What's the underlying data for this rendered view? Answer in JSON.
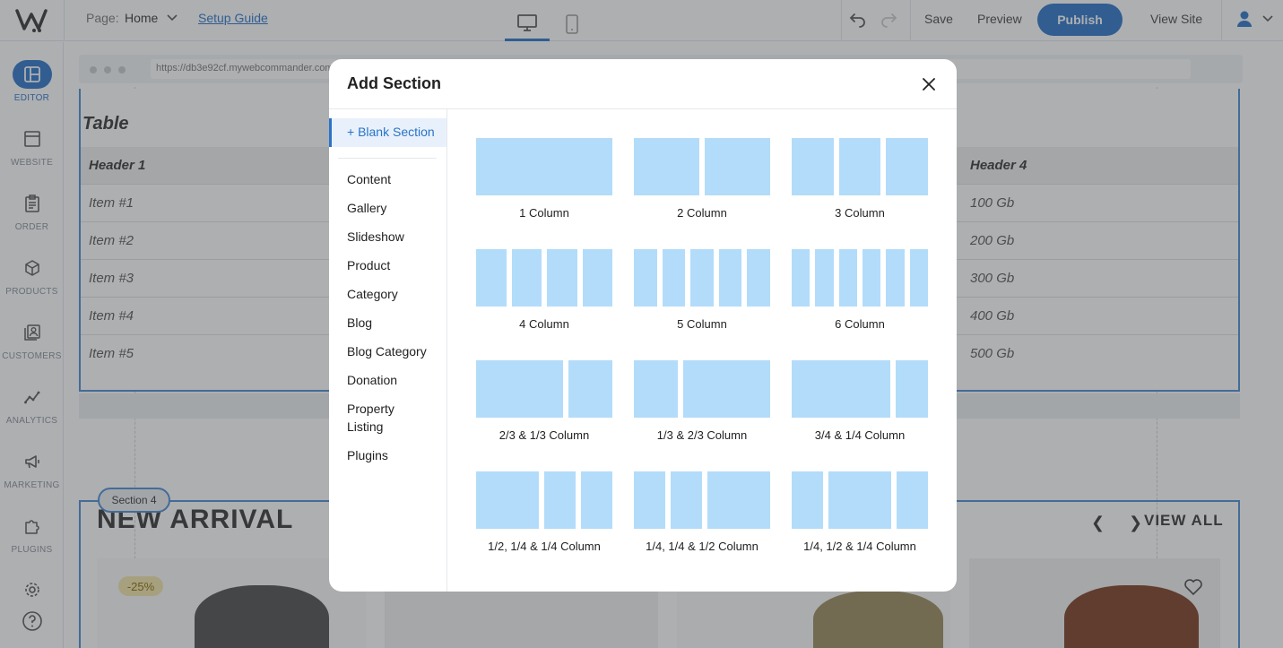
{
  "topbar": {
    "page_label": "Page:",
    "page_value": "Home",
    "setup_guide": "Setup Guide",
    "save": "Save",
    "preview": "Preview",
    "publish": "Publish",
    "view_site": "View Site"
  },
  "sidebar": {
    "items": [
      {
        "label": "EDITOR",
        "icon": "editor-icon",
        "active": true
      },
      {
        "label": "WEBSITE",
        "icon": "website-icon"
      },
      {
        "label": "ORDER",
        "icon": "order-icon"
      },
      {
        "label": "PRODUCTS",
        "icon": "products-icon"
      },
      {
        "label": "CUSTOMERS",
        "icon": "customers-icon"
      },
      {
        "label": "ANALYTICS",
        "icon": "analytics-icon"
      },
      {
        "label": "MARKETING",
        "icon": "marketing-icon"
      },
      {
        "label": "PLUGINS",
        "icon": "plugins-icon"
      }
    ]
  },
  "canvas": {
    "url": "https://db3e92cf.mywebcommander.com",
    "table": {
      "title": "Table",
      "headers": [
        "Header 1",
        "Header 4"
      ],
      "rows": [
        [
          "Item #1",
          "100 Gb"
        ],
        [
          "Item #2",
          "200 Gb"
        ],
        [
          "Item #3",
          "300 Gb"
        ],
        [
          "Item #4",
          "400 Gb"
        ],
        [
          "Item #5",
          "500 Gb"
        ]
      ]
    },
    "section_tag": "Section 4",
    "arrivals_title": "NEW ARRIVAL",
    "view_all": "VIEW ALL",
    "discount": "-25%"
  },
  "modal": {
    "title": "Add Section",
    "blank_section": "+ Blank Section",
    "menu": [
      "Content",
      "Gallery",
      "Slideshow",
      "Product",
      "Category",
      "Blog",
      "Blog Category",
      "Donation",
      "Property Listing",
      "Plugins"
    ],
    "layouts": [
      {
        "label": "1 Column",
        "widths": [
          1
        ]
      },
      {
        "label": "2 Column",
        "widths": [
          1,
          1
        ]
      },
      {
        "label": "3 Column",
        "widths": [
          1,
          1,
          1
        ]
      },
      {
        "label": "4 Column",
        "widths": [
          1,
          1,
          1,
          1
        ]
      },
      {
        "label": "5 Column",
        "widths": [
          1,
          1,
          1,
          1,
          1
        ]
      },
      {
        "label": "6 Column",
        "widths": [
          1,
          1,
          1,
          1,
          1,
          1
        ]
      },
      {
        "label": "2/3 & 1/3 Column",
        "widths": [
          2,
          1
        ]
      },
      {
        "label": "1/3 & 2/3 Column",
        "widths": [
          1,
          2
        ]
      },
      {
        "label": "3/4 & 1/4 Column",
        "widths": [
          3,
          1
        ]
      },
      {
        "label": "1/2, 1/4 & 1/4 Column",
        "widths": [
          2,
          1,
          1
        ]
      },
      {
        "label": "1/4, 1/4 & 1/2 Column",
        "widths": [
          1,
          1,
          2
        ]
      },
      {
        "label": "1/4, 1/2 & 1/4 Column",
        "widths": [
          1,
          2,
          1
        ]
      }
    ]
  },
  "colors": {
    "accent": "#2a73c8",
    "column_block": "#b3dcfa"
  }
}
